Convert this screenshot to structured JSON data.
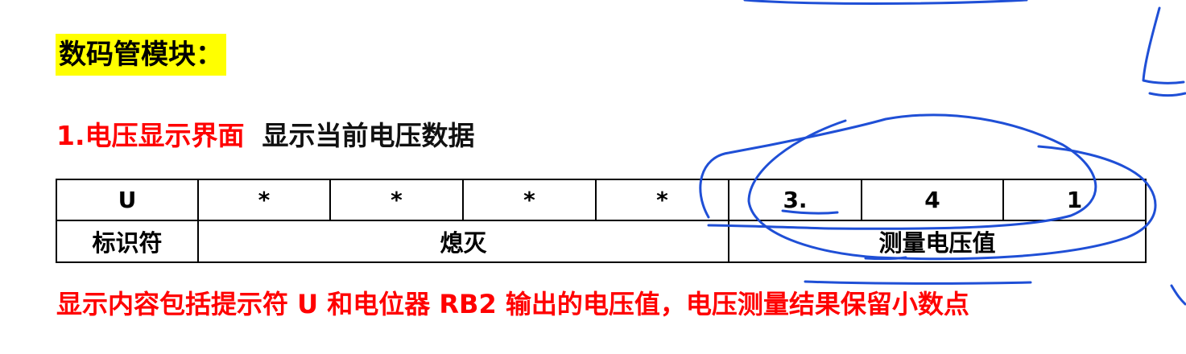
{
  "heading": "数码管模块：",
  "section": {
    "number_title": "1.电压显示界面",
    "description": "显示当前电压数据"
  },
  "table": {
    "digits": [
      "U",
      "*",
      "*",
      "*",
      "*",
      "3.",
      "4",
      "1"
    ],
    "labels": {
      "identifier": "标识符",
      "off": "熄灭",
      "measured": "测量电压值"
    }
  },
  "note": "显示内容包括提示符 U 和电位器 RB2 输出的电压值，电压测量结果保留小数点",
  "colors": {
    "highlight": "#ffff00",
    "red_text": "#ff0000",
    "annotation_ink": "#1f4fd6"
  }
}
